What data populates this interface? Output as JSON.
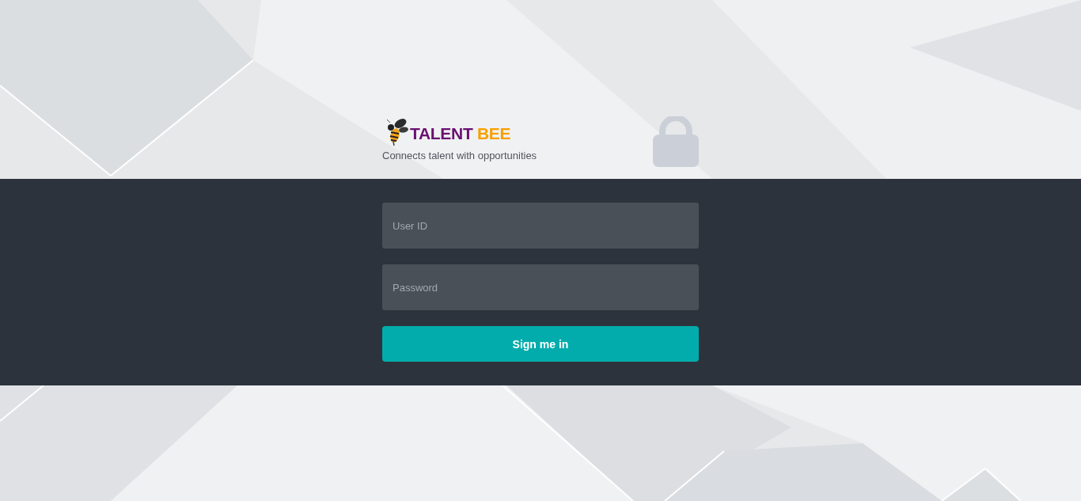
{
  "brand": {
    "words": [
      {
        "text": "TALENT",
        "color": "#6a0f70"
      },
      {
        "text": "BEE",
        "color": "#f7a000"
      }
    ],
    "tagline": "Connects talent with opportunities"
  },
  "form": {
    "fields": [
      {
        "placeholder": "User ID"
      },
      {
        "placeholder": "Password"
      }
    ],
    "submit": "Sign me in"
  }
}
